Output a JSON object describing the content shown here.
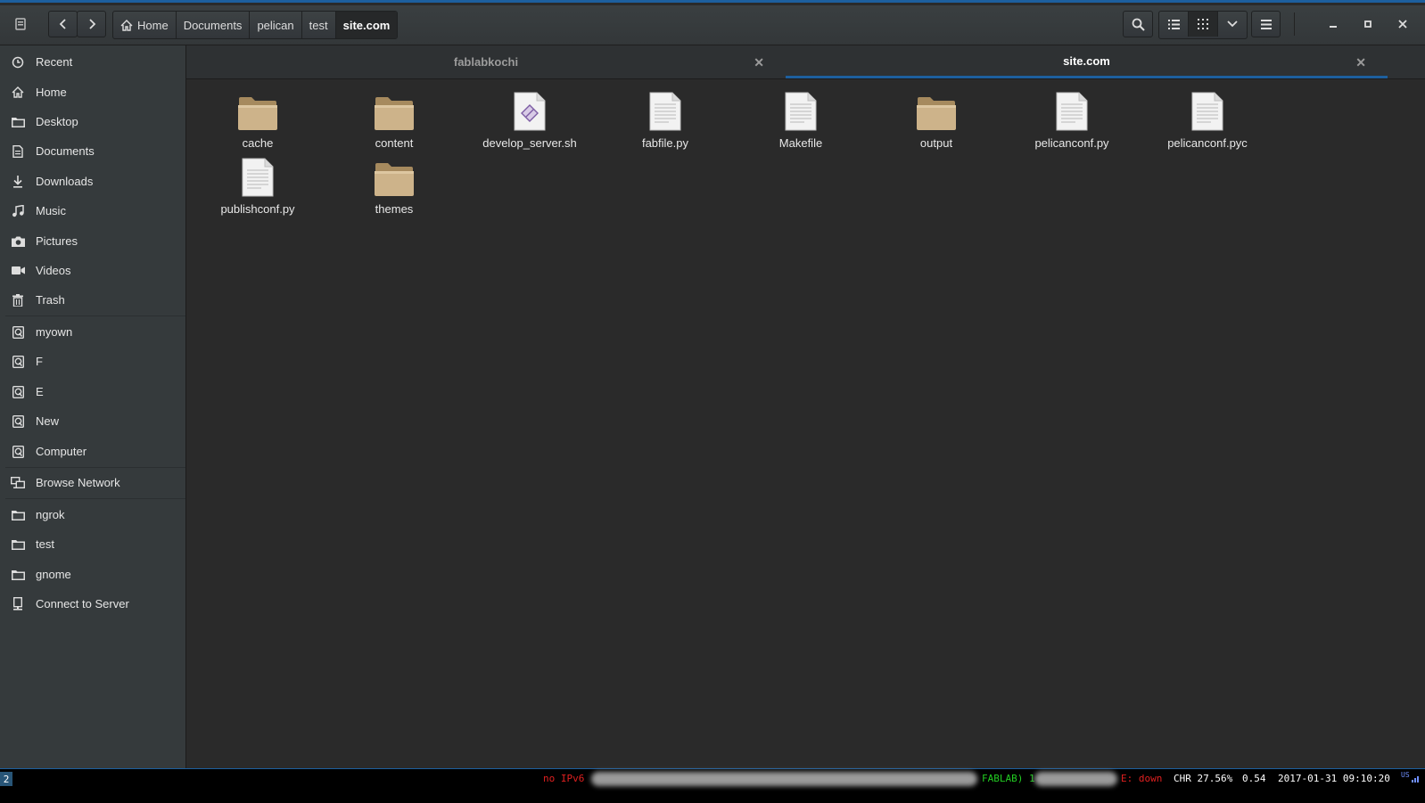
{
  "breadcrumb": [
    "Home",
    "Documents",
    "pelican",
    "test",
    "site.com"
  ],
  "sidebar": {
    "places": [
      "Recent",
      "Home",
      "Desktop",
      "Documents",
      "Downloads",
      "Music",
      "Pictures",
      "Videos",
      "Trash"
    ],
    "devices": [
      "myown",
      "F",
      "E",
      "New",
      "Computer"
    ],
    "network": [
      "Browse Network"
    ],
    "bookmarks": [
      "ngrok",
      "test",
      "gnome",
      "Connect to Server"
    ]
  },
  "tabs": [
    "fablabkochi",
    "site.com"
  ],
  "files": [
    {
      "name": "cache",
      "type": "folder"
    },
    {
      "name": "content",
      "type": "folder"
    },
    {
      "name": "develop_server.sh",
      "type": "script"
    },
    {
      "name": "fabfile.py",
      "type": "text"
    },
    {
      "name": "Makefile",
      "type": "text"
    },
    {
      "name": "output",
      "type": "folder"
    },
    {
      "name": "pelicanconf.py",
      "type": "text"
    },
    {
      "name": "pelicanconf.pyc",
      "type": "text"
    },
    {
      "name": "publishconf.py",
      "type": "text"
    },
    {
      "name": "themes",
      "type": "folder"
    }
  ],
  "statusbar": {
    "workspace": "2",
    "ipv6": "no IPv6",
    "wifi": "FABLAB) 1",
    "ethernet": "E: down",
    "chr": "CHR 27.56%",
    "load": "0.54",
    "datetime": "2017-01-31 09:10:20",
    "keyboard": "US"
  },
  "colors": {
    "accent": "#1d5f9e",
    "folder": "#cdb38a"
  }
}
